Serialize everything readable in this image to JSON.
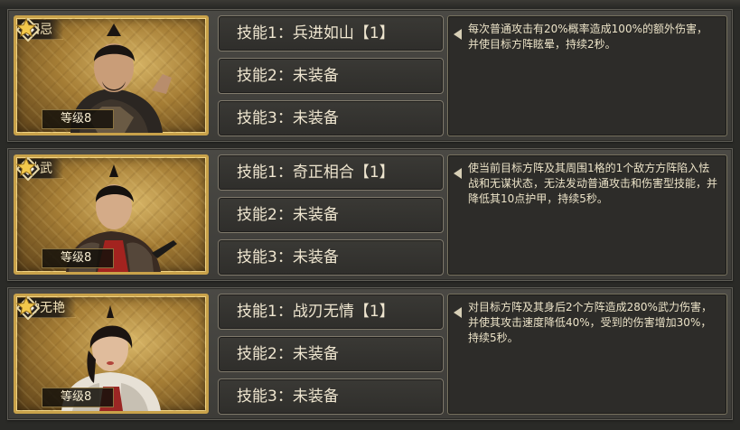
{
  "heroes": [
    {
      "name": "田忌",
      "level": "等级8",
      "skills": [
        "技能1：兵进如山【1】",
        "技能2：未装备",
        "技能3：未装备"
      ],
      "description": "每次普通攻击有20%概率造成100%的额外伤害，并使目标方阵眩晕，持续2秒。"
    },
    {
      "name": "孙武",
      "level": "等级8",
      "skills": [
        "技能1：奇正相合【1】",
        "技能2：未装备",
        "技能3：未装备"
      ],
      "description": "使当前目标方阵及其周围1格的1个敌方方阵陷入怯战和无谋状态，无法发动普通攻击和伤害型技能，并降低其10点护甲，持续5秒。"
    },
    {
      "name": "钟无艳",
      "level": "等级8",
      "skills": [
        "技能1：战刃无情【1】",
        "技能2：未装备",
        "技能3：未装备"
      ],
      "description": "对目标方阵及其身后2个方阵造成280%武力伤害，并使其攻击速度降低40%，受到的伤害增加30%，持续5秒。"
    }
  ],
  "icons": {
    "rank": "gem-icon",
    "star": "star-icon",
    "pointer": "arrow-left-icon"
  },
  "colors": {
    "frame_gold": "#c9a24a",
    "panel_bg": "#3d3c38",
    "text": "#efe6d0"
  }
}
